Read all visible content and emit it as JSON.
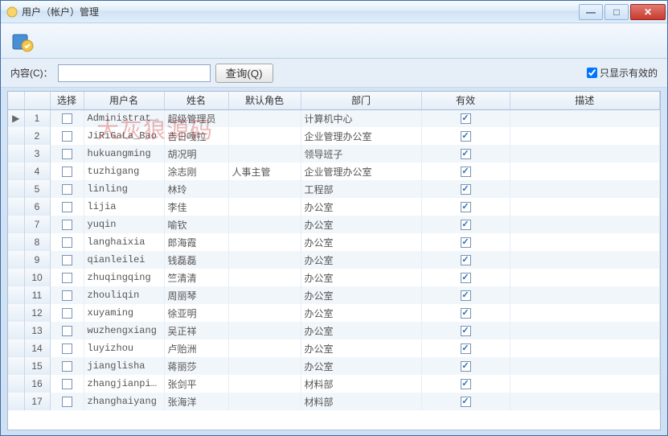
{
  "window": {
    "title": "用户（帐户）管理"
  },
  "filter": {
    "label": "内容(C)：",
    "value": "",
    "query_btn": "查询(Q)",
    "show_valid_label": "只显示有效的",
    "show_valid_checked": true
  },
  "columns": {
    "select": "选择",
    "username": "用户名",
    "name": "姓名",
    "default_role": "默认角色",
    "department": "部门",
    "valid": "有效",
    "description": "描述"
  },
  "watermark": "大灰狼源码",
  "rows": [
    {
      "n": 1,
      "sel": false,
      "current": true,
      "user": "Administrator",
      "name": "超级管理员",
      "role": "",
      "dept": "计算机中心",
      "valid": true,
      "desc": ""
    },
    {
      "n": 2,
      "sel": false,
      "current": false,
      "user": "JiRiGaLa_Bao",
      "name": "吉日嘎拉",
      "role": "",
      "dept": "企业管理办公室",
      "valid": true,
      "desc": ""
    },
    {
      "n": 3,
      "sel": false,
      "current": false,
      "user": "hukuangming",
      "name": "胡况明",
      "role": "",
      "dept": "领导班子",
      "valid": true,
      "desc": ""
    },
    {
      "n": 4,
      "sel": false,
      "current": false,
      "user": "tuzhigang",
      "name": "涂志刚",
      "role": "人事主管",
      "dept": "企业管理办公室",
      "valid": true,
      "desc": ""
    },
    {
      "n": 5,
      "sel": false,
      "current": false,
      "user": "linling",
      "name": "林玲",
      "role": "",
      "dept": "工程部",
      "valid": true,
      "desc": ""
    },
    {
      "n": 6,
      "sel": false,
      "current": false,
      "user": "lijia",
      "name": "李佳",
      "role": "",
      "dept": "办公室",
      "valid": true,
      "desc": ""
    },
    {
      "n": 7,
      "sel": false,
      "current": false,
      "user": "yuqin",
      "name": "喻钦",
      "role": "",
      "dept": "办公室",
      "valid": true,
      "desc": ""
    },
    {
      "n": 8,
      "sel": false,
      "current": false,
      "user": "langhaixia",
      "name": "郎海霞",
      "role": "",
      "dept": "办公室",
      "valid": true,
      "desc": ""
    },
    {
      "n": 9,
      "sel": false,
      "current": false,
      "user": "qianleilei",
      "name": "钱磊磊",
      "role": "",
      "dept": "办公室",
      "valid": true,
      "desc": ""
    },
    {
      "n": 10,
      "sel": false,
      "current": false,
      "user": "zhuqingqing",
      "name": "竺清清",
      "role": "",
      "dept": "办公室",
      "valid": true,
      "desc": ""
    },
    {
      "n": 11,
      "sel": false,
      "current": false,
      "user": "zhouliqin",
      "name": "周丽琴",
      "role": "",
      "dept": "办公室",
      "valid": true,
      "desc": ""
    },
    {
      "n": 12,
      "sel": false,
      "current": false,
      "user": "xuyaming",
      "name": "徐亚明",
      "role": "",
      "dept": "办公室",
      "valid": true,
      "desc": ""
    },
    {
      "n": 13,
      "sel": false,
      "current": false,
      "user": "wuzhengxiang",
      "name": "吴正祥",
      "role": "",
      "dept": "办公室",
      "valid": true,
      "desc": ""
    },
    {
      "n": 14,
      "sel": false,
      "current": false,
      "user": "luyizhou",
      "name": "卢贻洲",
      "role": "",
      "dept": "办公室",
      "valid": true,
      "desc": ""
    },
    {
      "n": 15,
      "sel": false,
      "current": false,
      "user": "jianglisha",
      "name": "蒋丽莎",
      "role": "",
      "dept": "办公室",
      "valid": true,
      "desc": ""
    },
    {
      "n": 16,
      "sel": false,
      "current": false,
      "user": "zhangjianping",
      "name": "张剑平",
      "role": "",
      "dept": "材料部",
      "valid": true,
      "desc": ""
    },
    {
      "n": 17,
      "sel": false,
      "current": false,
      "user": "zhanghaiyang",
      "name": "张海洋",
      "role": "",
      "dept": "材料部",
      "valid": true,
      "desc": ""
    }
  ]
}
